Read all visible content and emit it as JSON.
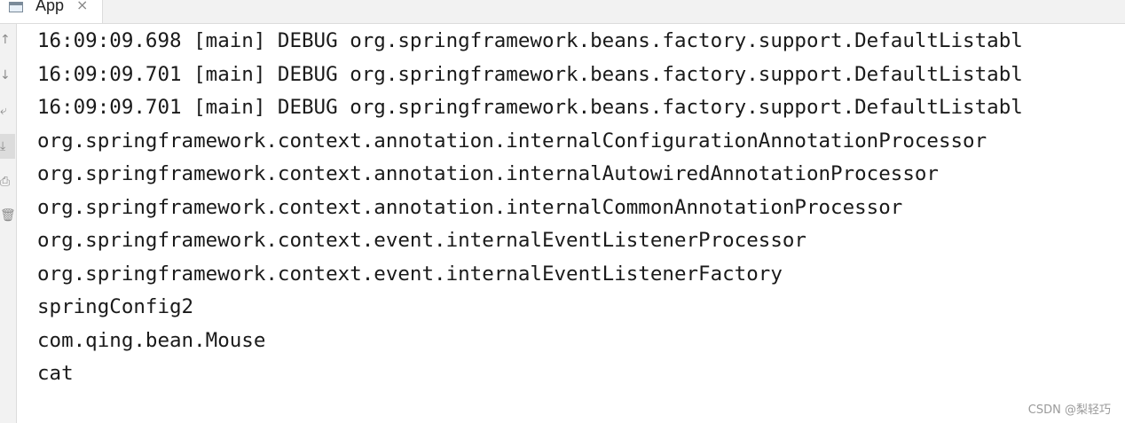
{
  "tab": {
    "title": "App",
    "close_glyph": "×",
    "icon": "console-window-icon"
  },
  "gutter": {
    "buttons": [
      {
        "icon": "arrow-up-icon",
        "glyph": "↑"
      },
      {
        "icon": "arrow-down-icon",
        "glyph": "↓"
      },
      {
        "icon": "soft-wrap-icon",
        "glyph": "⤶"
      },
      {
        "icon": "scroll-to-end-icon",
        "glyph": "⤓"
      },
      {
        "icon": "print-icon",
        "glyph": "⎙"
      },
      {
        "icon": "trash-icon",
        "glyph": "🗑"
      }
    ]
  },
  "console": {
    "lines": [
      "16:09:09.698 [main] DEBUG org.springframework.beans.factory.support.DefaultListabl",
      "16:09:09.701 [main] DEBUG org.springframework.beans.factory.support.DefaultListabl",
      "16:09:09.701 [main] DEBUG org.springframework.beans.factory.support.DefaultListabl",
      "org.springframework.context.annotation.internalConfigurationAnnotationProcessor",
      "org.springframework.context.annotation.internalAutowiredAnnotationProcessor",
      "org.springframework.context.annotation.internalCommonAnnotationProcessor",
      "org.springframework.context.event.internalEventListenerProcessor",
      "org.springframework.context.event.internalEventListenerFactory",
      "springConfig2",
      "com.qing.bean.Mouse",
      "cat"
    ]
  },
  "watermark": "CSDN @梨轻巧"
}
